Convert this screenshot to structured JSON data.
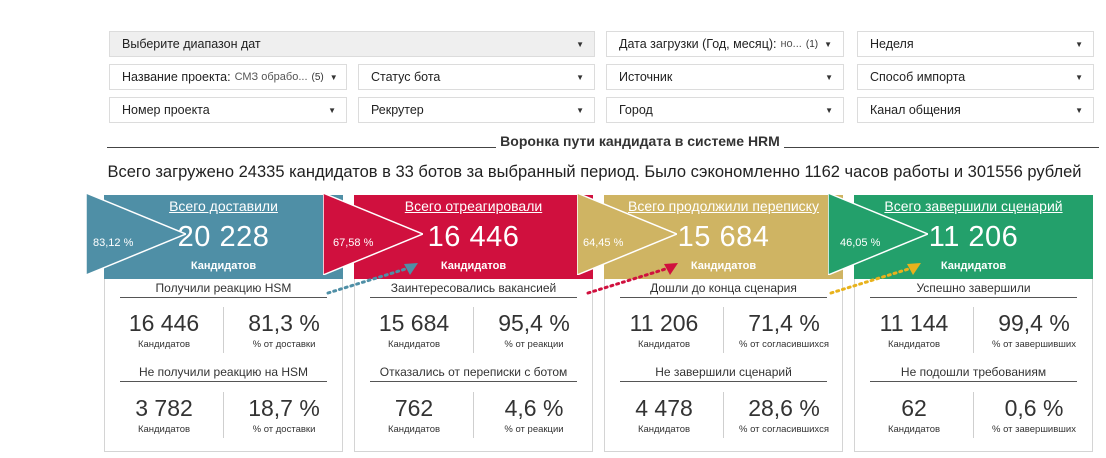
{
  "filters": {
    "date_range": {
      "label": "Выберите диапазон дат"
    },
    "upload_date": {
      "label": "Дата загрузки (Год, месяц):",
      "value": "но...",
      "count": "(1)"
    },
    "week": {
      "label": "Неделя"
    },
    "project_name": {
      "label": "Название проекта:",
      "value": "СМЗ обрабо...",
      "count": "(5)"
    },
    "bot_status": {
      "label": "Статус бота"
    },
    "source": {
      "label": "Источник"
    },
    "import_method": {
      "label": "Способ импорта"
    },
    "project_number": {
      "label": "Номер проекта"
    },
    "recruiter": {
      "label": "Рекрутер"
    },
    "city": {
      "label": "Город"
    },
    "channel": {
      "label": "Канал общения"
    }
  },
  "section_title": "Воронка пути кандидата в системе HRM",
  "summary": "Всего загружено 24335 кандидатов в 33 ботов за выбранный период. Было сэкономленно 1162 часов работы и 301556 рублей",
  "colors": {
    "delivered": "#4f8fa6",
    "reacted": "#d0103e",
    "continued": "#cfb463",
    "completed": "#23a06b",
    "dot_blue": "#4f8fa6",
    "dot_red": "#d0103e",
    "dot_yellow": "#e8b21c"
  },
  "stages": [
    {
      "title": "Всего доставили",
      "value": "20 228",
      "unit": "Кандидатов",
      "pct": "83,12 %",
      "top_label": "Получили реакцию HSM",
      "top_value": "16 446",
      "top_value_label": "Кандидатов",
      "top_pct": "81,3 %",
      "top_pct_label": "% от доставки",
      "bottom_label": "Не получили реакцию на HSM",
      "bottom_value": "3 782",
      "bottom_value_label": "Кандидатов",
      "bottom_pct": "18,7 %",
      "bottom_pct_label": "% от доставки"
    },
    {
      "title": "Всего отреагировали",
      "value": "16 446",
      "unit": "Кандидатов",
      "pct": "67,58 %",
      "top_label": "Заинтересовались вакансией",
      "top_value": "15 684",
      "top_value_label": "Кандидатов",
      "top_pct": "95,4 %",
      "top_pct_label": "% от реакции",
      "bottom_label": "Отказались от переписки с ботом",
      "bottom_value": "762",
      "bottom_value_label": "Кандидатов",
      "bottom_pct": "4,6 %",
      "bottom_pct_label": "% от реакции"
    },
    {
      "title": "Всего продолжили переписку",
      "value": "15 684",
      "unit": "Кандидатов",
      "pct": "64,45 %",
      "top_label": "Дошли до конца сценария",
      "top_value": "11 206",
      "top_value_label": "Кандидатов",
      "top_pct": "71,4 %",
      "top_pct_label": "% от согласившихся",
      "bottom_label": "Не завершили сценарий",
      "bottom_value": "4 478",
      "bottom_value_label": "Кандидатов",
      "bottom_pct": "28,6 %",
      "bottom_pct_label": "% от согласившихся"
    },
    {
      "title": "Всего завершили сценарий",
      "value": "11 206",
      "unit": "Кандидатов",
      "pct": "46,05 %",
      "top_label": "Успешно завершили",
      "top_value": "11 144",
      "top_value_label": "Кандидатов",
      "top_pct": "99,4 %",
      "top_pct_label": "% от завершивших",
      "bottom_label": "Не подошли требованиям",
      "bottom_value": "62",
      "bottom_value_label": "Кандидатов",
      "bottom_pct": "0,6 %",
      "bottom_pct_label": "% от завершивших"
    }
  ]
}
